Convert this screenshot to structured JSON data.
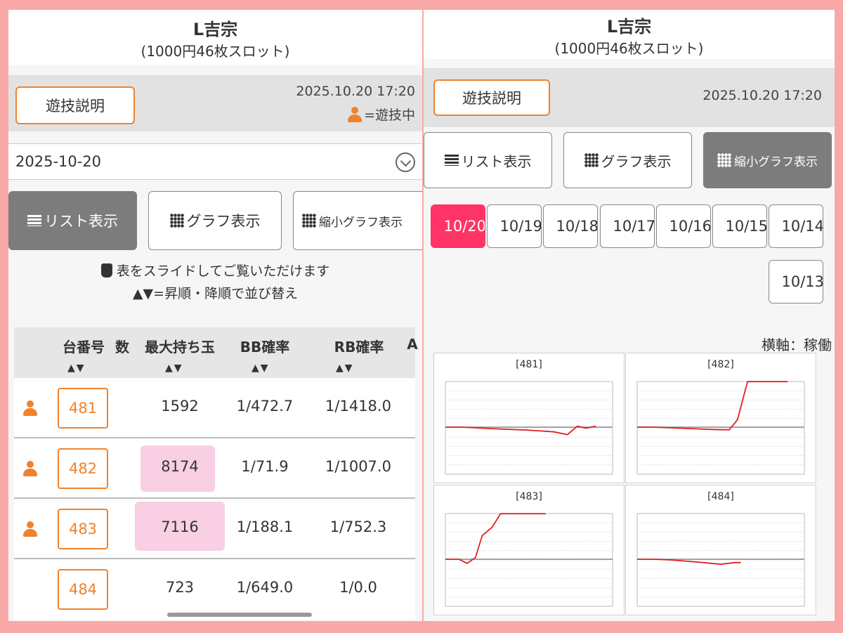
{
  "left": {
    "title": "L吉宗",
    "subtitle": "(1000円46枚スロット)",
    "explain_button": "遊技説明",
    "timestamp": "2025.10.20 17:20",
    "playing_legend": "=遊技中",
    "selected_date": "2025-10-20",
    "views": {
      "list": "リスト表示",
      "graph": "グラフ表示",
      "mini_graph": "縮小グラフ表示"
    },
    "hint_line1": "表をスライドしてご覧いただけます",
    "hint_line2": "▲▼=昇順・降順で並び替え",
    "table": {
      "headers": {
        "machine": "台番号",
        "count": "数",
        "max_balls": "最大持ち玉",
        "bb": "BB確率",
        "rb": "RB確率",
        "a": "A"
      },
      "sort_arrows": "▲▼",
      "rows": [
        {
          "machine": "481",
          "playing": true,
          "max_balls": "1592",
          "bb": "1/472.7",
          "rb": "1/1418.0"
        },
        {
          "machine": "482",
          "playing": true,
          "max_balls": "8174",
          "bb": "1/71.9",
          "rb": "1/1007.0"
        },
        {
          "machine": "483",
          "playing": true,
          "max_balls": "7116",
          "bb": "1/188.1",
          "rb": "1/752.3"
        },
        {
          "machine": "484",
          "playing": false,
          "max_balls": "723",
          "bb": "1/649.0",
          "rb": "1/0.0"
        }
      ]
    }
  },
  "right": {
    "title": "L吉宗",
    "subtitle": "(1000円46枚スロット)",
    "explain_button": "遊技説明",
    "timestamp": "2025.10.20 17:20",
    "views": {
      "list": "リスト表示",
      "graph": "グラフ表示",
      "mini_graph": "縮小グラフ表示"
    },
    "date_tabs": [
      "10/20",
      "10/19",
      "10/18",
      "10/17",
      "10/16",
      "10/15",
      "10/14",
      "10/13"
    ],
    "axis_label": "横軸：稼働",
    "graphs": [
      {
        "label": "[481]",
        "points": [
          [
            0,
            0
          ],
          [
            0.1,
            0
          ],
          [
            0.3,
            -0.05
          ],
          [
            0.5,
            -0.09
          ],
          [
            0.65,
            -0.14
          ],
          [
            0.73,
            -0.22
          ],
          [
            0.79,
            0.03
          ],
          [
            0.84,
            -0.03
          ],
          [
            0.9,
            0.03
          ]
        ]
      },
      {
        "label": "[482]",
        "points": [
          [
            0,
            0
          ],
          [
            0.1,
            0
          ],
          [
            0.3,
            -0.04
          ],
          [
            0.45,
            -0.07
          ],
          [
            0.55,
            -0.08
          ],
          [
            0.6,
            0.22
          ],
          [
            0.66,
            1.35
          ],
          [
            0.68,
            1.35
          ],
          [
            0.9,
            1.35
          ]
        ]
      },
      {
        "label": "[483]",
        "points": [
          [
            0,
            0
          ],
          [
            0.08,
            0
          ],
          [
            0.13,
            -0.12
          ],
          [
            0.18,
            0.05
          ],
          [
            0.22,
            0.7
          ],
          [
            0.28,
            0.95
          ],
          [
            0.33,
            1.35
          ],
          [
            0.55,
            1.35
          ],
          [
            0.6,
            1.35
          ]
        ]
      },
      {
        "label": "[484]",
        "points": [
          [
            0,
            0
          ],
          [
            0.1,
            0
          ],
          [
            0.2,
            -0.02
          ],
          [
            0.3,
            -0.06
          ],
          [
            0.4,
            -0.1
          ],
          [
            0.5,
            -0.15
          ],
          [
            0.58,
            -0.1
          ],
          [
            0.62,
            -0.1
          ]
        ]
      }
    ]
  },
  "colors": {
    "accent": "#f0822c",
    "active_date": "#ff3366",
    "active_view": "#7c7c7c",
    "frame": "#f9a8a8",
    "graph_line": "#dd2222",
    "highlight": "#f8cfe3"
  }
}
